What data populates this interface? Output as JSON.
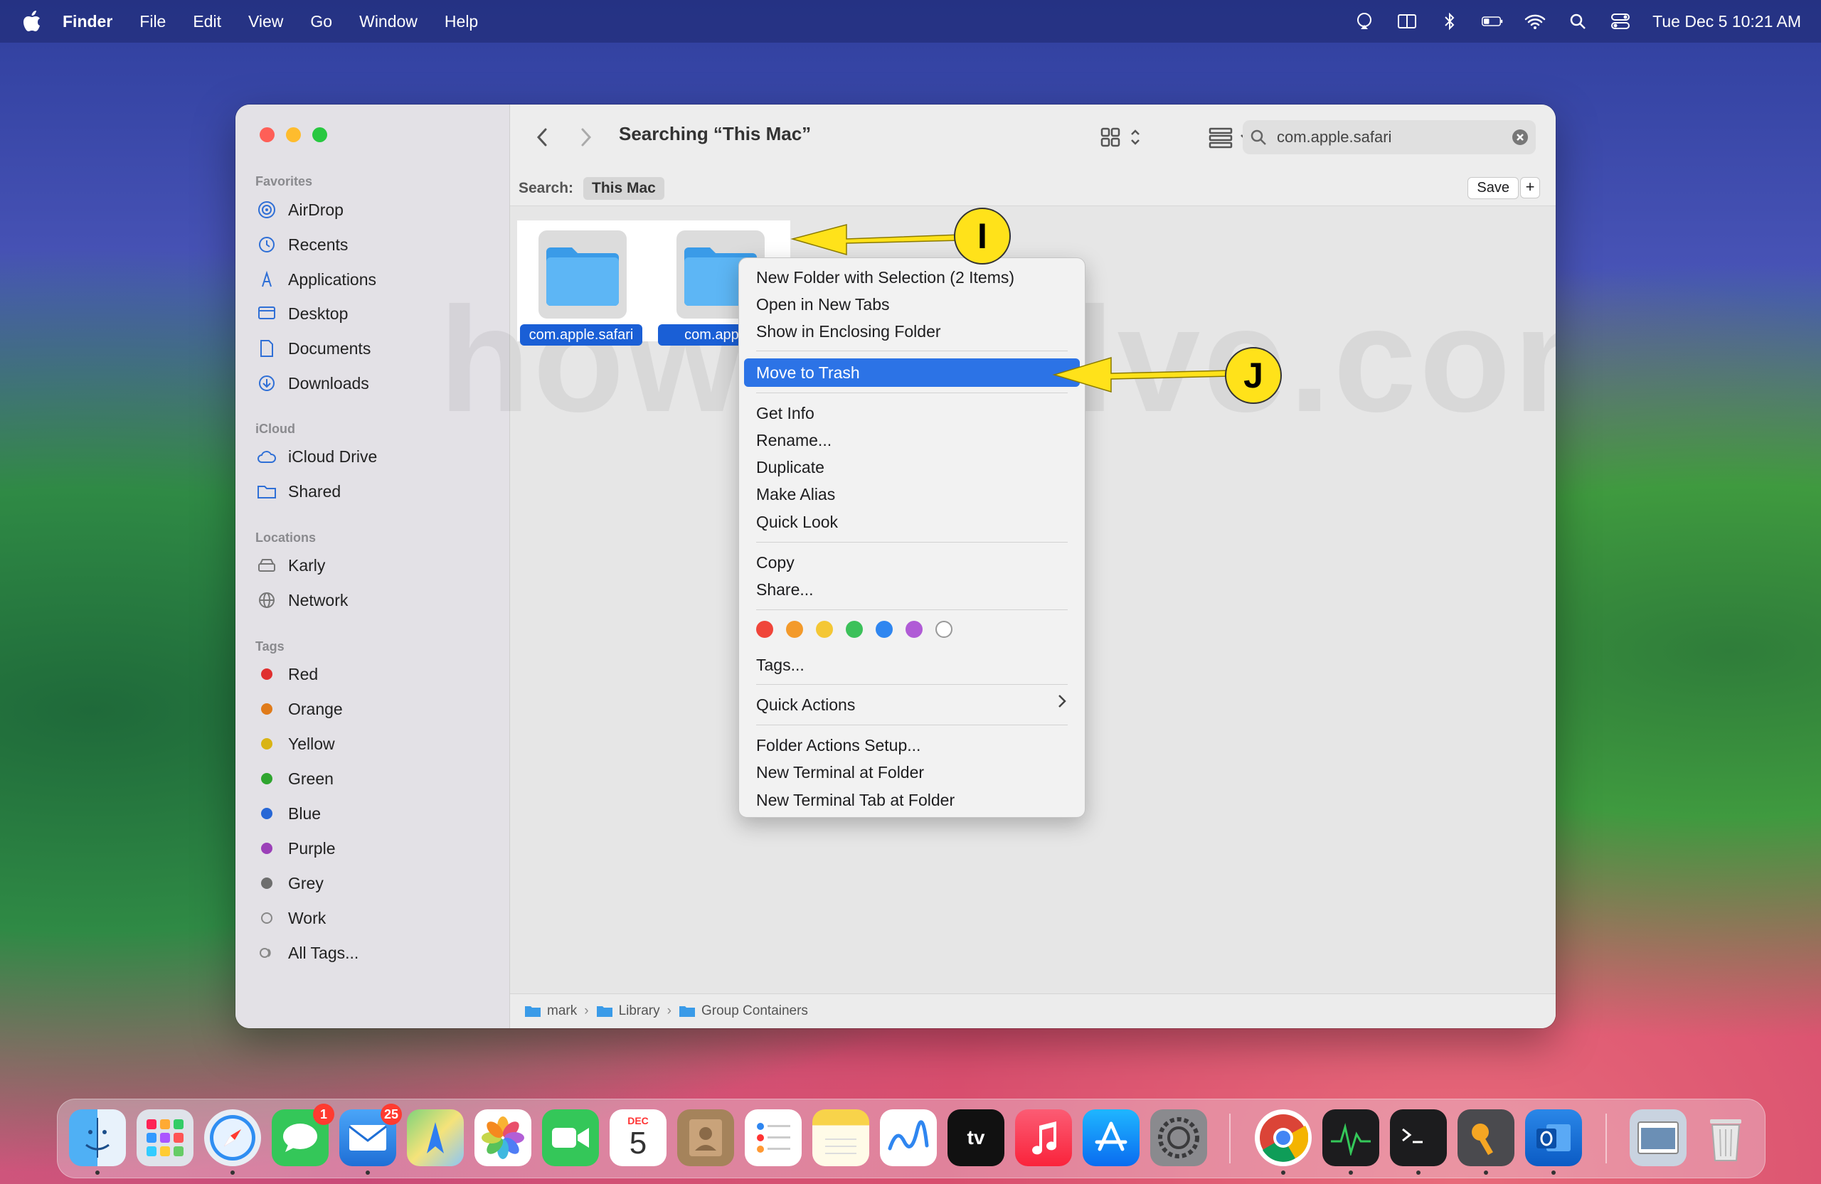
{
  "menubar": {
    "app_name": "Finder",
    "items": [
      "File",
      "Edit",
      "View",
      "Go",
      "Window",
      "Help"
    ],
    "clock": "Tue Dec 5  10:21 AM"
  },
  "window": {
    "title": "Searching “This Mac”",
    "search_value": "com.apple.safari",
    "scope_label": "Search:",
    "scope_value": "This Mac",
    "save_label": "Save",
    "plus_label": "+"
  },
  "sidebar": {
    "favorites_header": "Favorites",
    "favorites": [
      "AirDrop",
      "Recents",
      "Applications",
      "Desktop",
      "Documents",
      "Downloads"
    ],
    "icloud_header": "iCloud",
    "icloud": [
      "iCloud Drive",
      "Shared"
    ],
    "locations_header": "Locations",
    "locations": [
      "Karly",
      "Network"
    ],
    "tags_header": "Tags",
    "tags": [
      {
        "label": "Red",
        "color": "#e02f2f"
      },
      {
        "label": "Orange",
        "color": "#e07b1a"
      },
      {
        "label": "Yellow",
        "color": "#d9b414"
      },
      {
        "label": "Green",
        "color": "#2fa52f"
      },
      {
        "label": "Blue",
        "color": "#2767d6"
      },
      {
        "label": "Purple",
        "color": "#9b40b8"
      },
      {
        "label": "Grey",
        "color": "#6e6e6e"
      },
      {
        "label": "Work",
        "color": ""
      },
      {
        "label": "All Tags...",
        "color": ""
      }
    ]
  },
  "files": [
    "com.apple.safari",
    "com.apple."
  ],
  "watermark": "howtosolve.com",
  "pathbar": [
    "mark",
    "Library",
    "Group Containers"
  ],
  "context_menu": {
    "group1": [
      "New Folder with Selection (2 Items)",
      "Open in New Tabs",
      "Show in Enclosing Folder"
    ],
    "highlighted": "Move to Trash",
    "group2": [
      "Get Info",
      "Rename...",
      "Duplicate",
      "Make Alias",
      "Quick Look"
    ],
    "group3": [
      "Copy",
      "Share..."
    ],
    "tag_colors": [
      "#f0453a",
      "#f39a2b",
      "#f4c735",
      "#3cc15a",
      "#2f86f0",
      "#b05bd6",
      "#ffffff"
    ],
    "tags_item": "Tags...",
    "quick_actions": "Quick Actions",
    "group4": [
      "Folder Actions Setup...",
      "New Terminal at Folder",
      "New Terminal Tab at Folder"
    ]
  },
  "annotations": {
    "badge_i": "I",
    "badge_j": "J",
    "accent": "#ffe21a"
  },
  "dock": {
    "mail_badge": "25",
    "messages_badge": "1",
    "calendar_month": "DEC",
    "calendar_day": "5",
    "tv_label": "tv"
  }
}
